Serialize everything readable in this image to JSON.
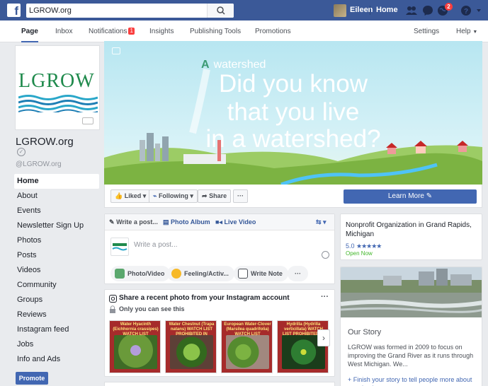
{
  "topbar": {
    "search_value": "LGROW.org",
    "user_name": "Eileen",
    "home_label": "Home",
    "notifications_badge": "2",
    "brand_color": "#3b5998"
  },
  "pagenav": {
    "tabs": [
      "Page",
      "Inbox",
      "Notifications",
      "Insights",
      "Publishing Tools",
      "Promotions"
    ],
    "notifications_count": "1",
    "settings": "Settings",
    "help": "Help"
  },
  "profile": {
    "logo_text": "LGROW",
    "page_name": "LGROW.org",
    "handle": "@LGROW.org"
  },
  "leftnav": {
    "items": [
      "Home",
      "About",
      "Events",
      "Newsletter Sign Up",
      "Photos",
      "Posts",
      "Videos",
      "Community",
      "Groups",
      "Reviews",
      "Instagram feed",
      "Jobs",
      "Info and Ads"
    ],
    "promote": "Promote"
  },
  "cover": {
    "small_a": "A",
    "small_watershed": "watershed",
    "line1": "Did you know",
    "line2": "that you live",
    "line3": "in a watershed?"
  },
  "actions": {
    "liked": "Liked ▾",
    "following": "Following ▾",
    "share": "Share",
    "more": "···",
    "learn_more": "Learn More"
  },
  "composer": {
    "write_post": "Write a post...",
    "photo_album": "Photo Album",
    "live_video": "Live Video",
    "placeholder": "Write a post...",
    "photo_video": "Photo/Video",
    "feeling": "Feeling/Activ...",
    "write_note": "Write Note",
    "more": "···"
  },
  "instagram": {
    "title": "Share a recent photo from your Instagram account",
    "subtitle": "Only you can see this",
    "more": "···",
    "thumbs": [
      {
        "caption": "Water Hyacinth (Eichhornia crassipes) WATCH LIST"
      },
      {
        "caption": "Water Chestnut (Trapa natans) WATCH LIST PROHIBITED IN MICHIGAN"
      },
      {
        "caption": "European Water-Clover (Marsilea quadrifolia) WATCH LIST"
      },
      {
        "caption": "Hydrilla (Hydrilla verticillata) WATCH LIST PROHIBITED IN MICHIGAN"
      }
    ]
  },
  "about": {
    "category": "Nonprofit Organization in Grand Rapids, Michigan",
    "rating": "5.0",
    "stars": "★★★★★",
    "open_now": "Open Now"
  },
  "story": {
    "title": "Our Story",
    "body": "LGROW was formed in 2009 to focus on improving the Grand River as it runs through West Michigan. We...",
    "link": "+ Finish your story to tell people more about your business"
  }
}
